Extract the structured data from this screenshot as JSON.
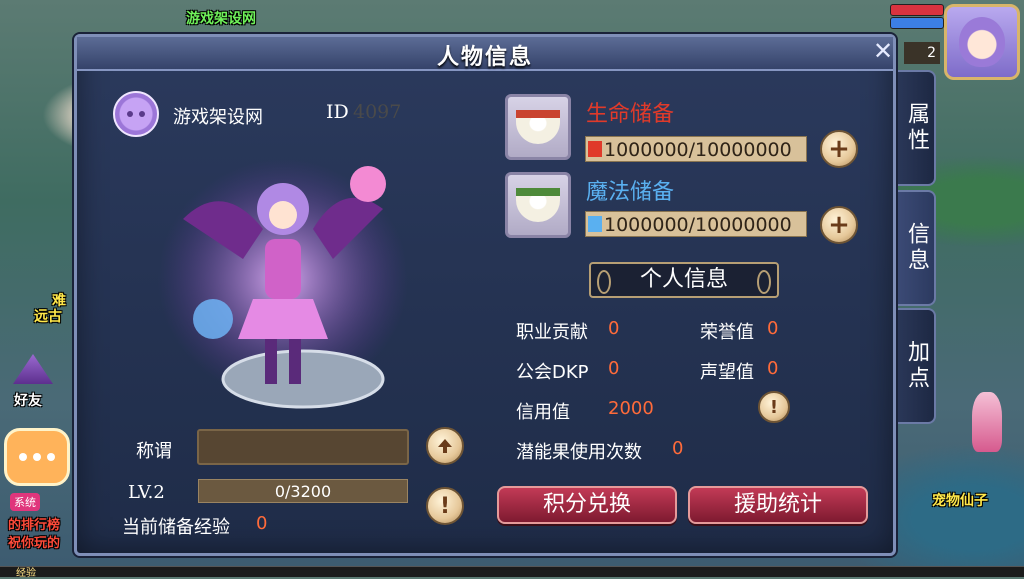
{
  "panel": {
    "title": "人物信息",
    "close_icon": "✕"
  },
  "side_tabs": [
    "属性",
    "信息",
    "加点"
  ],
  "player": {
    "name": "游戏架设网",
    "id_label": "ID",
    "id_value": "4097"
  },
  "title_row": {
    "label": "称谓"
  },
  "level_row": {
    "label": "LV.2",
    "exp_text": "0/3200"
  },
  "stored_exp": {
    "label": "当前储备经验",
    "value": "0"
  },
  "life_reserve": {
    "title": "生命储备",
    "bar_text": "1000000/10000000",
    "color": "#e03a2a",
    "fill_ratio": 0.1
  },
  "magic_reserve": {
    "title": "魔法储备",
    "bar_text": "1000000/10000000",
    "color": "#5ab0f0",
    "fill_ratio": 0.1
  },
  "personal_info": {
    "header": "个人信息",
    "stats": [
      {
        "label": "职业贡献",
        "value": "0"
      },
      {
        "label": "荣誉值",
        "value": "0"
      },
      {
        "label": "公会DKP",
        "value": "0"
      },
      {
        "label": "声望值",
        "value": "0"
      },
      {
        "label": "信用值",
        "value": "2000"
      },
      {
        "label": "潜能果使用次数",
        "value": "0"
      }
    ]
  },
  "buttons": {
    "points_exchange": "积分兑换",
    "assist_stats": "援助统计",
    "plus_icon": "+",
    "info_icon": "!"
  },
  "hud": {
    "player_level": "2",
    "friend_label": "好友",
    "pet_label": "宠物仙子",
    "bg_texts": [
      "游戏架设网",
      "难",
      "远古",
      "的排行榜",
      "祝你玩的"
    ],
    "system_tag": "系统",
    "exp_label": "经验"
  },
  "colors": {
    "panel_bg": "#1f2c48",
    "accent_gold": "#b79f74",
    "stat_value": "#ff6b3a",
    "button_red": "#c23a56"
  }
}
